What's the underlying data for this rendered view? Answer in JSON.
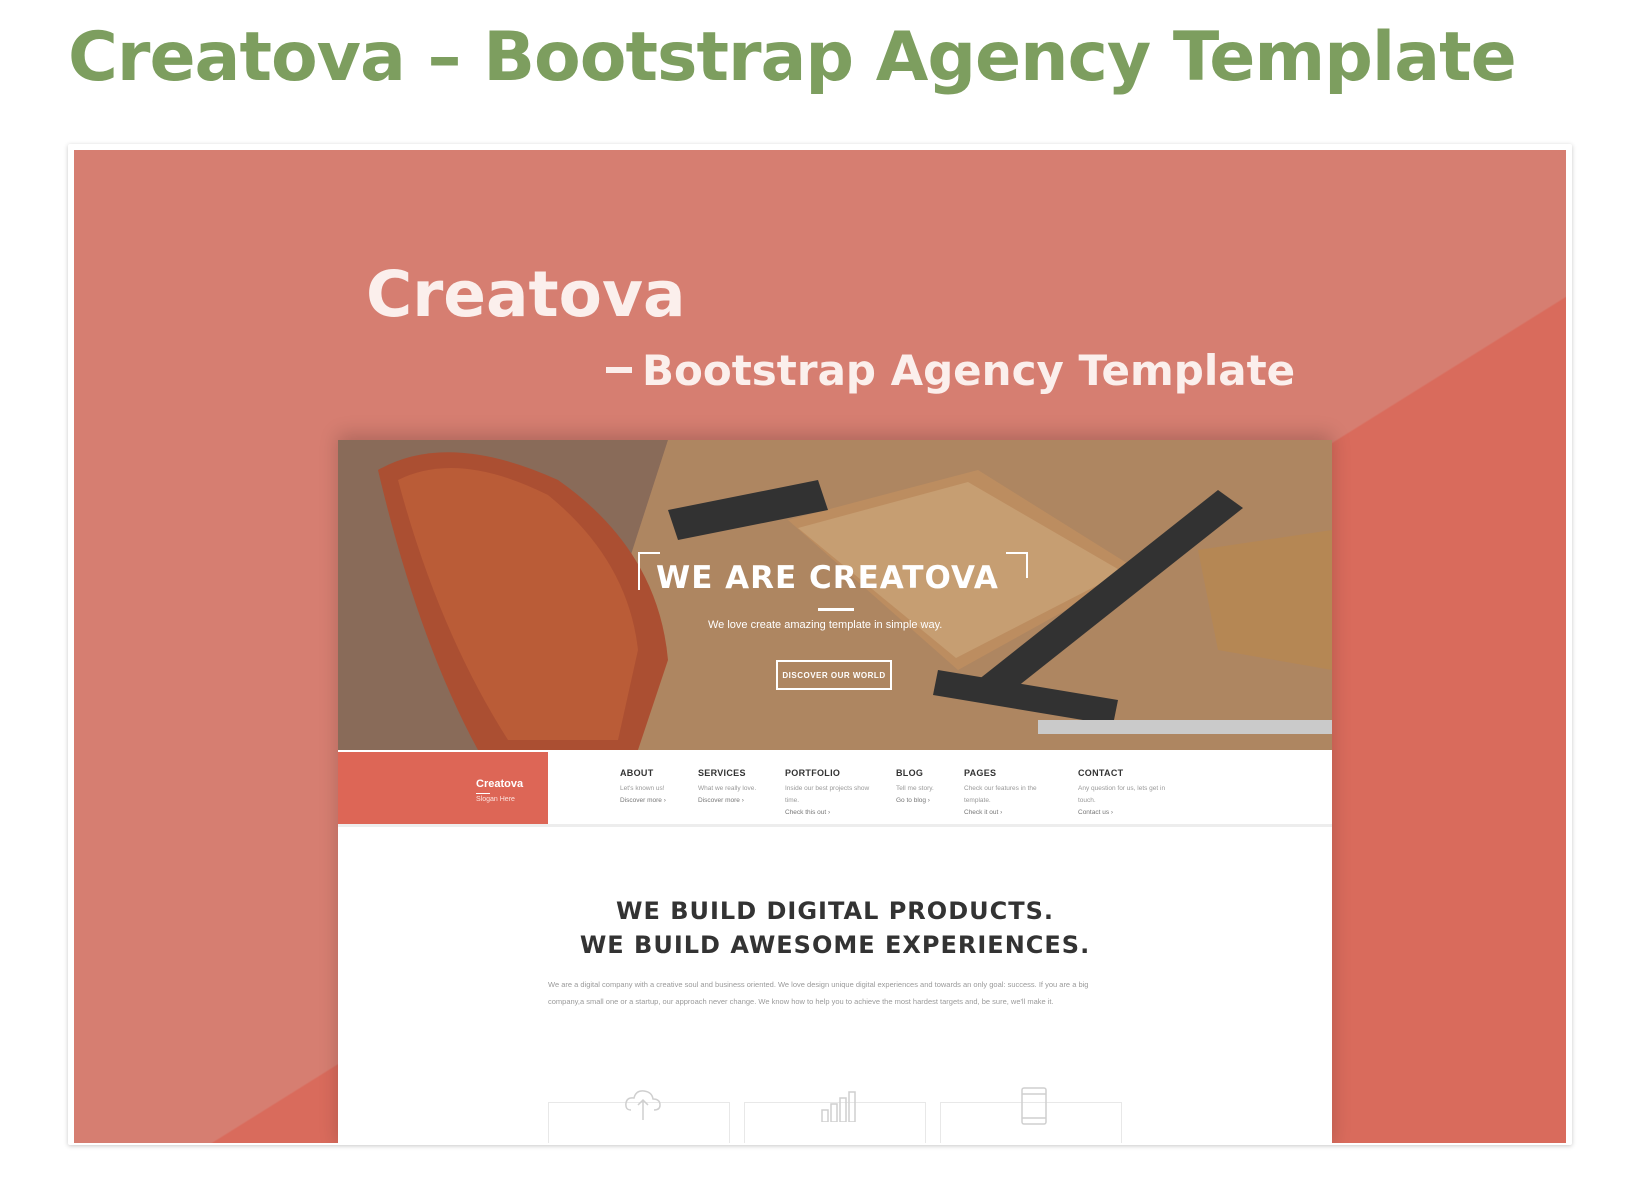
{
  "page": {
    "heading": "Creatova – Bootstrap Agency Template"
  },
  "banner": {
    "title": "Creatova",
    "subtitle": "Bootstrap Agency Template",
    "colors": {
      "background": "#d67e71",
      "background_dark": "#d96b5c",
      "heading": "#7d9e5f",
      "brand": "#dd6656"
    }
  },
  "hero": {
    "title": "WE ARE CREATOVA",
    "tagline": "We love create amazing template in simple way.",
    "button_label": "DISCOVER OUR WORLD"
  },
  "brand": {
    "name": "Creatova",
    "slogan": "Slogan Here"
  },
  "nav": [
    {
      "title": "ABOUT",
      "desc": "Let's known us!",
      "link": "Discover more ›"
    },
    {
      "title": "SERVICES",
      "desc": "What we really love.",
      "link": "Discover more ›"
    },
    {
      "title": "PORTFOLIO",
      "desc": "Inside our best projects show time.",
      "link": "Check this out ›"
    },
    {
      "title": "BLOG",
      "desc": "Tell me story.",
      "link": "Go to blog ›"
    },
    {
      "title": "PAGES",
      "desc": "Check our features in the template.",
      "link": "Check it out ›"
    },
    {
      "title": "CONTACT",
      "desc": "Any question for us, lets get in touch.",
      "link": "Contact us ›"
    }
  ],
  "section": {
    "headline_1": "WE BUILD DIGITAL PRODUCTS.",
    "headline_2": "WE BUILD AWESOME EXPERIENCES.",
    "body": "We are a digital company with a creative soul and business oriented. We love design unique digital experiences and towards an only goal: success. If you are a big company,a small one or a startup, our approach never change. We know how to help you to achieve the most hardest targets and, be sure, we'll make it."
  },
  "icons": {
    "feature_1": "cloud-upload-icon",
    "feature_2": "bar-chart-icon",
    "feature_3": "mobile-device-icon"
  }
}
